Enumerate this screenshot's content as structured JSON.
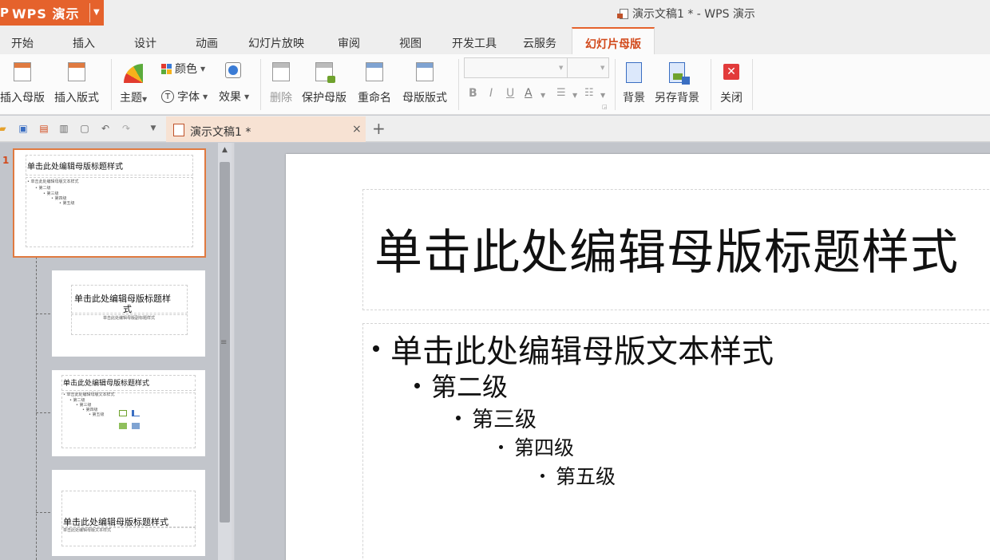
{
  "app": {
    "logo_glyph": "P",
    "name": "WPS 演示",
    "window_title": "演示文稿1 * - WPS 演示"
  },
  "menu": {
    "tabs": [
      "开始",
      "插入",
      "设计",
      "动画",
      "幻灯片放映",
      "审阅",
      "视图",
      "开发工具",
      "云服务"
    ],
    "active": "幻灯片母版"
  },
  "ribbon": {
    "insert_master": "插入母版",
    "insert_layout": "插入版式",
    "theme": "主题",
    "color": "颜色",
    "font": "字体",
    "effect": "效果",
    "delete": "删除",
    "protect_master": "保护母版",
    "rename": "重命名",
    "master_layout": "母版版式",
    "bold": "B",
    "italic": "I",
    "underline": "U",
    "font_color": "A",
    "background": "背景",
    "save_background": "另存背景",
    "close": "关闭",
    "font_name": "",
    "font_size": ""
  },
  "document_tab": {
    "label": "演示文稿1 *",
    "close_glyph": "×",
    "new_tab_glyph": "+"
  },
  "thumbnails": {
    "slide_number": "1",
    "master_title": "单击此处编辑母版标题样式",
    "master_body": "• 单击此处编辑母版文本样式",
    "levels": [
      "• 第二级",
      "• 第三级",
      "• 第四级",
      "• 第五级"
    ],
    "layout1_title": "单击此处编辑母版标题样",
    "layout1_title2": "式",
    "layout1_sub": "单击此处编辑母版副标题样式",
    "layout2_title": "单击此处编辑母版标题样式",
    "layout2_body": "• 单击此处编辑母版文本样式",
    "layout3_title": "单击此处编辑母版标题样式",
    "layout3_sub": "单击此处编辑母版文本样式"
  },
  "slide": {
    "title": "单击此处编辑母版标题样式",
    "body": [
      "单击此处编辑母版文本样式",
      "第二级",
      "第三级",
      "第四级",
      "第五级"
    ]
  },
  "colors": {
    "accent": "#e5622c",
    "active_tab_text": "#d24a1c"
  }
}
